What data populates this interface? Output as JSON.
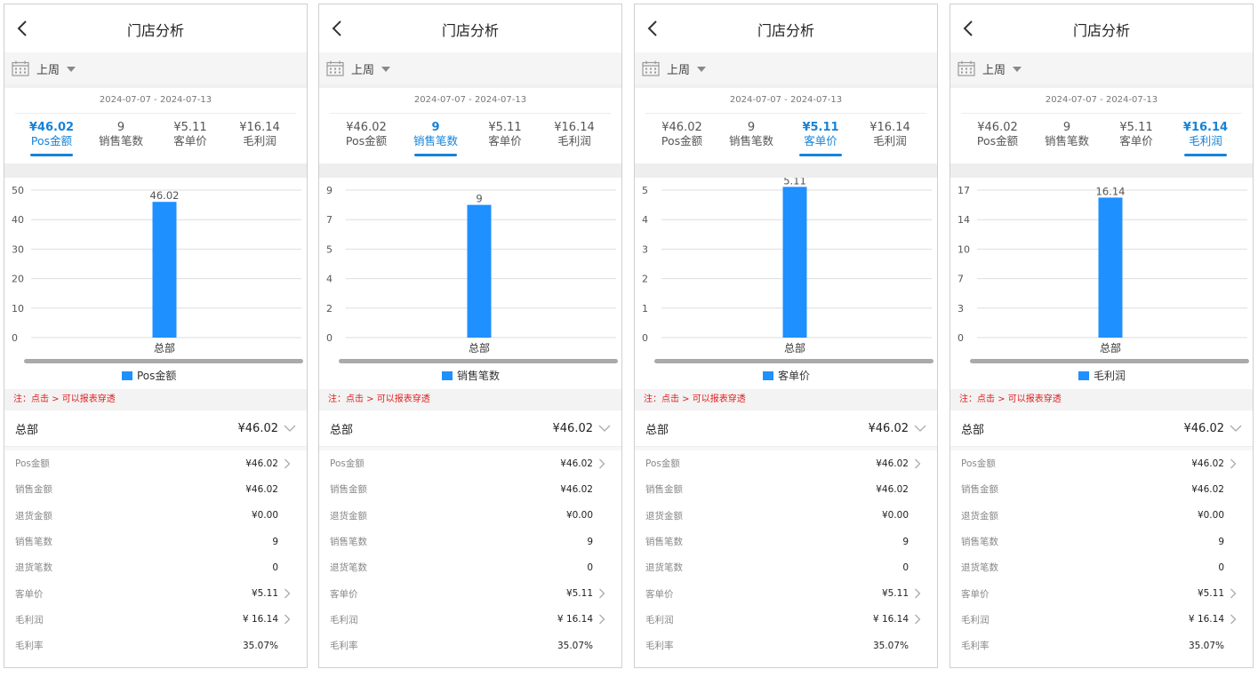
{
  "colors": {
    "accent": "#1683d8",
    "bar": "#1e90ff",
    "note": "#e02020"
  },
  "icons": {
    "back": "chevron-left-icon",
    "calendar": "calendar-icon",
    "dropdown": "caret-down-icon",
    "expand": "chevron-down-icon",
    "drill": "chevron-right-icon"
  },
  "screens": [
    {
      "title": "门店分析",
      "period": "上周",
      "date_range": "2024-07-07 - 2024-07-13",
      "tabs": [
        {
          "value": "¥46.02",
          "label": "Pos金额"
        },
        {
          "value": "9",
          "label": "销售笔数"
        },
        {
          "value": "¥5.11",
          "label": "客单价"
        },
        {
          "value": "¥16.14",
          "label": "毛利润"
        }
      ],
      "active_tab": 0,
      "note": "注：点击 > 可以报表穿透",
      "summary": {
        "name": "总部",
        "value": "¥46.02"
      },
      "rows": [
        {
          "label": "Pos金额",
          "value": "¥46.02",
          "drill": true
        },
        {
          "label": "销售金额",
          "value": "¥46.02",
          "drill": false
        },
        {
          "label": "退货金额",
          "value": "¥0.00",
          "drill": false
        },
        {
          "label": "销售笔数",
          "value": "9",
          "drill": false
        },
        {
          "label": "退货笔数",
          "value": "0",
          "drill": false
        },
        {
          "label": "客单价",
          "value": "¥5.11",
          "drill": true
        },
        {
          "label": "毛利润",
          "value": "¥ 16.14",
          "drill": true
        },
        {
          "label": "毛利率",
          "value": "35.07%",
          "drill": false
        }
      ],
      "chart_data": {
        "type": "bar",
        "categories": [
          "总部"
        ],
        "series": [
          {
            "name": "Pos金额",
            "values": [
              46.02
            ]
          }
        ],
        "data_labels": [
          "46.02"
        ],
        "ylim": [
          0,
          50
        ],
        "yticks": [
          "0",
          "10",
          "20",
          "30",
          "40",
          "50"
        ],
        "grid": true,
        "legend": "bottom"
      }
    },
    {
      "title": "门店分析",
      "period": "上周",
      "date_range": "2024-07-07 - 2024-07-13",
      "tabs": [
        {
          "value": "¥46.02",
          "label": "Pos金额"
        },
        {
          "value": "9",
          "label": "销售笔数"
        },
        {
          "value": "¥5.11",
          "label": "客单价"
        },
        {
          "value": "¥16.14",
          "label": "毛利润"
        }
      ],
      "active_tab": 1,
      "note": "注：点击 > 可以报表穿透",
      "summary": {
        "name": "总部",
        "value": "¥46.02"
      },
      "rows": [
        {
          "label": "Pos金额",
          "value": "¥46.02",
          "drill": true
        },
        {
          "label": "销售金额",
          "value": "¥46.02",
          "drill": false
        },
        {
          "label": "退货金额",
          "value": "¥0.00",
          "drill": false
        },
        {
          "label": "销售笔数",
          "value": "9",
          "drill": false
        },
        {
          "label": "退货笔数",
          "value": "0",
          "drill": false
        },
        {
          "label": "客单价",
          "value": "¥5.11",
          "drill": true
        },
        {
          "label": "毛利润",
          "value": "¥ 16.14",
          "drill": true
        },
        {
          "label": "毛利率",
          "value": "35.07%",
          "drill": false
        }
      ],
      "chart_data": {
        "type": "bar",
        "categories": [
          "总部"
        ],
        "series": [
          {
            "name": "销售笔数",
            "values": [
              9
            ]
          }
        ],
        "data_labels": [
          "9"
        ],
        "ylim": [
          0,
          10
        ],
        "yticks": [
          "0",
          "2",
          "4",
          "5",
          "7",
          "9"
        ],
        "grid": true,
        "legend": "bottom"
      }
    },
    {
      "title": "门店分析",
      "period": "上周",
      "date_range": "2024-07-07 - 2024-07-13",
      "tabs": [
        {
          "value": "¥46.02",
          "label": "Pos金额"
        },
        {
          "value": "9",
          "label": "销售笔数"
        },
        {
          "value": "¥5.11",
          "label": "客单价"
        },
        {
          "value": "¥16.14",
          "label": "毛利润"
        }
      ],
      "active_tab": 2,
      "note": "注：点击 > 可以报表穿透",
      "summary": {
        "name": "总部",
        "value": "¥46.02"
      },
      "rows": [
        {
          "label": "Pos金额",
          "value": "¥46.02",
          "drill": true
        },
        {
          "label": "销售金额",
          "value": "¥46.02",
          "drill": false
        },
        {
          "label": "退货金额",
          "value": "¥0.00",
          "drill": false
        },
        {
          "label": "销售笔数",
          "value": "9",
          "drill": false
        },
        {
          "label": "退货笔数",
          "value": "0",
          "drill": false
        },
        {
          "label": "客单价",
          "value": "¥5.11",
          "drill": true
        },
        {
          "label": "毛利润",
          "value": "¥ 16.14",
          "drill": true
        },
        {
          "label": "毛利率",
          "value": "35.07%",
          "drill": false
        }
      ],
      "chart_data": {
        "type": "bar",
        "categories": [
          "总部"
        ],
        "series": [
          {
            "name": "客单价",
            "values": [
              5.11
            ]
          }
        ],
        "data_labels": [
          "5.11"
        ],
        "ylim": [
          0,
          5
        ],
        "yticks": [
          "0",
          "1",
          "2",
          "3",
          "4",
          "5"
        ],
        "grid": true,
        "legend": "bottom"
      }
    },
    {
      "title": "门店分析",
      "period": "上周",
      "date_range": "2024-07-07 - 2024-07-13",
      "tabs": [
        {
          "value": "¥46.02",
          "label": "Pos金额"
        },
        {
          "value": "9",
          "label": "销售笔数"
        },
        {
          "value": "¥5.11",
          "label": "客单价"
        },
        {
          "value": "¥16.14",
          "label": "毛利润"
        }
      ],
      "active_tab": 3,
      "note": "注：点击 > 可以报表穿透",
      "summary": {
        "name": "总部",
        "value": "¥46.02"
      },
      "rows": [
        {
          "label": "Pos金额",
          "value": "¥46.02",
          "drill": true
        },
        {
          "label": "销售金额",
          "value": "¥46.02",
          "drill": false
        },
        {
          "label": "退货金额",
          "value": "¥0.00",
          "drill": false
        },
        {
          "label": "销售笔数",
          "value": "9",
          "drill": false
        },
        {
          "label": "退货笔数",
          "value": "0",
          "drill": false
        },
        {
          "label": "客单价",
          "value": "¥5.11",
          "drill": true
        },
        {
          "label": "毛利润",
          "value": "¥ 16.14",
          "drill": true
        },
        {
          "label": "毛利率",
          "value": "35.07%",
          "drill": false
        }
      ],
      "chart_data": {
        "type": "bar",
        "categories": [
          "总部"
        ],
        "series": [
          {
            "name": "毛利润",
            "values": [
              16.14
            ]
          }
        ],
        "data_labels": [
          "16.14"
        ],
        "ylim": [
          0,
          17
        ],
        "yticks": [
          "0",
          "3",
          "7",
          "10",
          "14",
          "17"
        ],
        "grid": true,
        "legend": "bottom"
      }
    }
  ]
}
